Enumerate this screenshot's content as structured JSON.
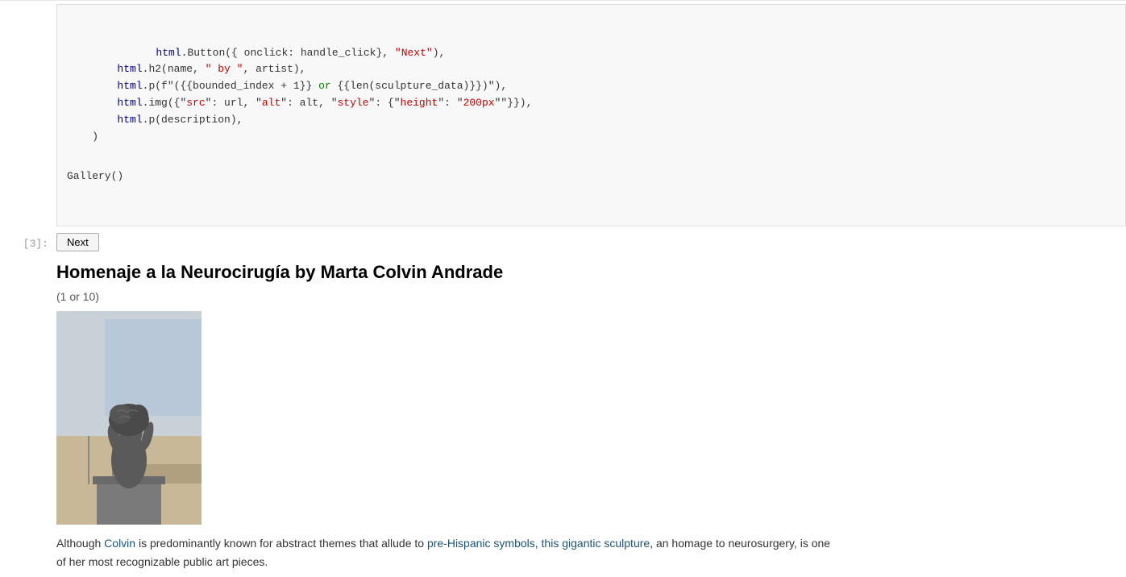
{
  "cell3": {
    "number": "[3]:",
    "code": {
      "lines": [
        {
          "indent": "indent2",
          "parts": [
            {
              "text": "html",
              "class": "html-obj"
            },
            {
              "text": ".Button({ onclick: handle_click}, ",
              "class": "plain"
            },
            {
              "text": "\"Next\"",
              "class": "val-str"
            },
            {
              "text": "),",
              "class": "plain"
            }
          ]
        },
        {
          "indent": "indent2",
          "parts": [
            {
              "text": "html",
              "class": "html-obj"
            },
            {
              "text": ".h2(name, ",
              "class": "plain"
            },
            {
              "text": "\" by \"",
              "class": "val-str"
            },
            {
              "text": ", artist),",
              "class": "plain"
            }
          ]
        },
        {
          "indent": "indent2",
          "parts": [
            {
              "text": "html",
              "class": "html-obj"
            },
            {
              "text": ".p(f\"({bounded_index + 1} ",
              "class": "plain"
            },
            {
              "text": "or",
              "class": "kw"
            },
            {
              "text": " {len(sculpture_data)})\"),",
              "class": "plain"
            }
          ]
        },
        {
          "indent": "indent2",
          "parts": [
            {
              "text": "html",
              "class": "html-obj"
            },
            {
              "text": ".img({",
              "class": "plain"
            },
            {
              "text": "\"src\"",
              "class": "val-str"
            },
            {
              "text": ": url, ",
              "class": "plain"
            },
            {
              "text": "\"alt\"",
              "class": "val-str"
            },
            {
              "text": ": alt, ",
              "class": "plain"
            },
            {
              "text": "\"style\"",
              "class": "val-str"
            },
            {
              "text": ": {",
              "class": "plain"
            },
            {
              "text": "\"height\"",
              "class": "val-str"
            },
            {
              "text": ": ",
              "class": "plain"
            },
            {
              "text": "\"200px\"",
              "class": "val-str"
            },
            {
              "text": "}}),",
              "class": "plain"
            }
          ]
        },
        {
          "indent": "indent2",
          "parts": [
            {
              "text": "html",
              "class": "html-obj"
            },
            {
              "text": ".p(description),",
              "class": "plain"
            }
          ]
        },
        {
          "indent": "indent1",
          "parts": [
            {
              "text": ")",
              "class": "plain"
            }
          ]
        }
      ],
      "gallery_call": "Gallery()"
    },
    "output": {
      "next_button_label": "Next",
      "title": "Homenaje a la Neurocirugía by Marta Colvin Andrade",
      "counter": "(1 or 10)",
      "description_parts": [
        {
          "text": "Although ",
          "class": "plain"
        },
        {
          "text": "Colvin",
          "class": "link"
        },
        {
          "text": " is predominantly known for abstract themes that allude to ",
          "class": "plain"
        },
        {
          "text": "pre-Hispanic symbols",
          "class": "link"
        },
        {
          "text": ", ",
          "class": "plain"
        },
        {
          "text": "this gigantic sculpture",
          "class": "link"
        },
        {
          "text": ", an homage to neurosurgery, is one of her most recognizable public art pieces.",
          "class": "plain"
        }
      ]
    }
  }
}
